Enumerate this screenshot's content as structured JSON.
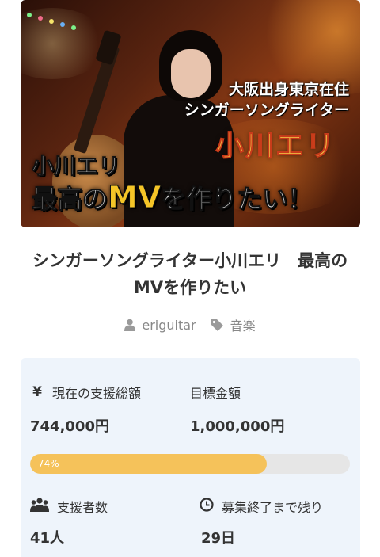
{
  "hero": {
    "tagline_line1": "大阪出身東京在住",
    "tagline_line2": "シンガーソングライター",
    "artist_name": "小川エリ",
    "caption_line1": "小川エリ",
    "caption_pre": "最高の",
    "caption_mv": "MV",
    "caption_post": "を作りたい！"
  },
  "project": {
    "title": "シンガーソングライター小川エリ　最高のMVを作りたい",
    "owner": "eriguitar",
    "category": "音楽"
  },
  "stats": {
    "current_label": "現在の支援総額",
    "current_value": "744,000円",
    "goal_label": "目標金額",
    "goal_value": "1,000,000円",
    "progress_text": "74%",
    "progress_fraction": 0.74,
    "backers_label": "支援者数",
    "backers_value": "41人",
    "remaining_label": "募集終了まで残り",
    "remaining_value": "29日"
  },
  "icons": {
    "yen": "¥",
    "user": "user-icon",
    "tag": "tag-icon",
    "users": "users-icon",
    "clock": "clock-icon"
  },
  "colors": {
    "progress_fill": "#f5c25a",
    "progress_track": "#e6e6e6",
    "card_bg": "#eef4fb",
    "meta_text": "#888888"
  }
}
